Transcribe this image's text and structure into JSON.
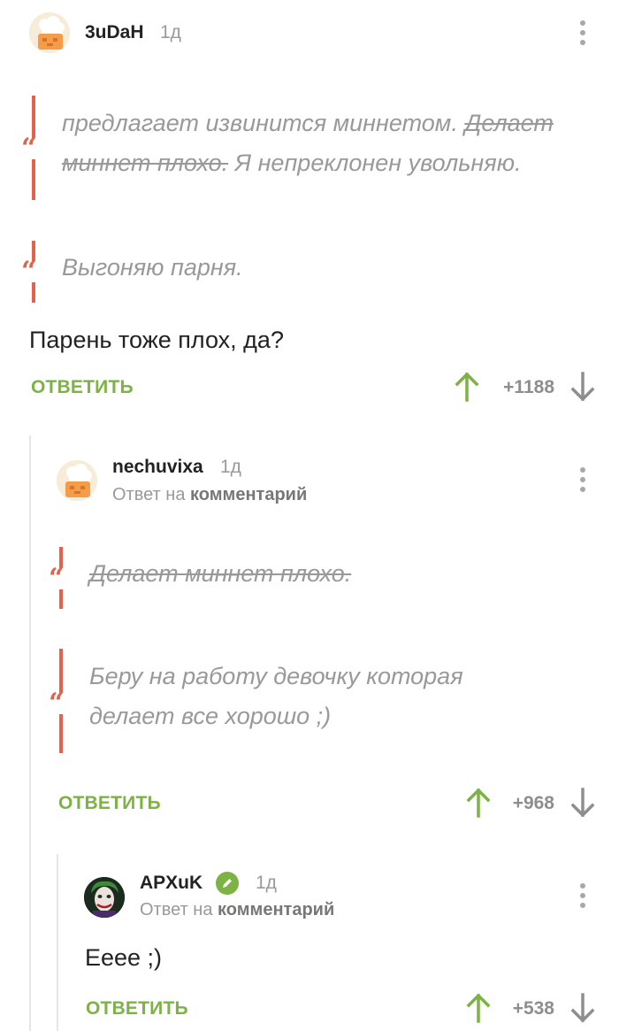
{
  "colors": {
    "accent_green": "#7cb342",
    "quote_red": "#e0644d",
    "muted": "#999999"
  },
  "comment1": {
    "author": "3uDaH",
    "age": "1д",
    "quote1_normal_1": "предлагает извинится миннетом. ",
    "quote1_struck_1": "Делает",
    "quote1_struck_2": "миннет плохо.",
    "quote1_normal_2": " Я непреклонен увольняю.",
    "quote2": "Выгоняю парня.",
    "text": "Парень тоже плох, да?",
    "reply_label": "ОТВЕТИТЬ",
    "score": "+1188"
  },
  "comment2": {
    "author": "nechuvixa",
    "age": "1д",
    "reply_to_prefix": "Ответ на",
    "reply_to_link": "комментарий",
    "quote1": "Делает миннет плохо.",
    "quote2_line1": "Беру на работу девочку которая",
    "quote2_line2": "делает все хорошо ;)",
    "reply_label": "ОТВЕТИТЬ",
    "score": "+968"
  },
  "comment3": {
    "author": "APXuK",
    "age": "1д",
    "reply_to_prefix": "Ответ на",
    "reply_to_link": "комментарий",
    "text": "Eeee ;)",
    "reply_label": "ОТВЕТИТЬ",
    "score": "+538"
  }
}
